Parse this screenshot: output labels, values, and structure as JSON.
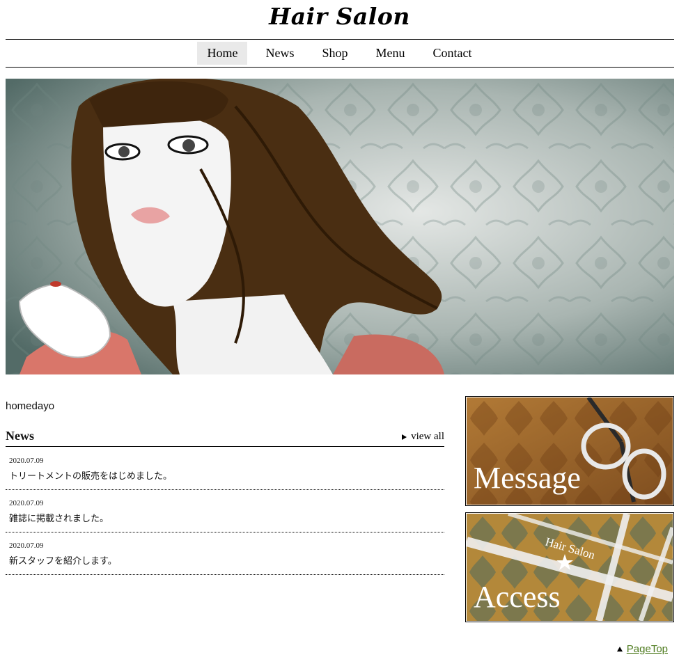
{
  "site": {
    "title": "Hair Salon"
  },
  "nav": {
    "items": [
      {
        "label": "Home",
        "active": true
      },
      {
        "label": "News"
      },
      {
        "label": "Shop"
      },
      {
        "label": "Menu"
      },
      {
        "label": "Contact"
      }
    ]
  },
  "hero": {
    "image": "hero-illustration-woman-with-long-brown-hair-on-damask-wallpaper"
  },
  "main": {
    "intro": "homedayo",
    "news": {
      "heading": "News",
      "view_all": "view all",
      "items": [
        {
          "date": "2020.07.09",
          "text": "トリートメントの販売をはじめました。"
        },
        {
          "date": "2020.07.09",
          "text": "雑誌に掲載されました。"
        },
        {
          "date": "2020.07.09",
          "text": "新スタッフを紹介します。"
        }
      ]
    }
  },
  "sidebar": {
    "message_banner": {
      "label": "Message",
      "image": "scissors-on-gold-damask"
    },
    "access_banner": {
      "label": "Access",
      "map_label": "Hair Salon",
      "image": "map-on-damask"
    }
  },
  "footer": {
    "page_top": "PageTop"
  },
  "colors": {
    "link_green": "#4d7a1d",
    "nav_active_bg": "#e9e9e9"
  }
}
